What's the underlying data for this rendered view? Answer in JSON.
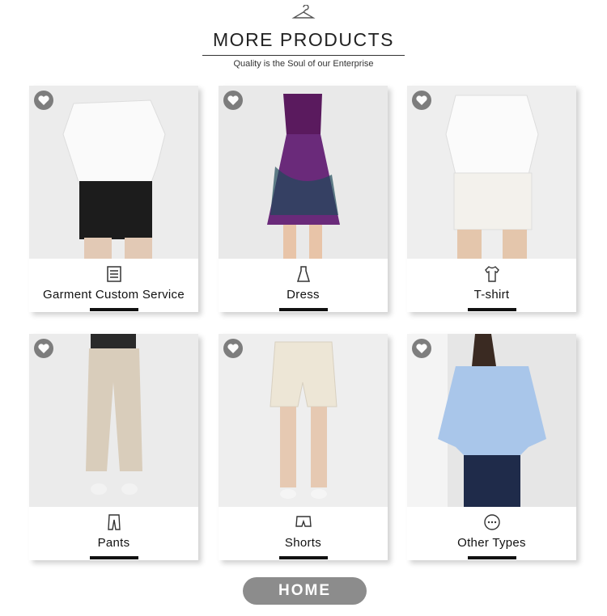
{
  "header": {
    "title": "MORE PRODUCTS",
    "subtitle": "Quality is the Soul of our Enterprise",
    "icon": "hanger-icon"
  },
  "categories": [
    {
      "label": "Garment Custom Service",
      "icon": "clipboard-list-icon",
      "photo": "white-blouse-black-denim-shorts",
      "bg": "#ececec"
    },
    {
      "label": "Dress",
      "icon": "dress-icon",
      "photo": "purple-print-dress",
      "bg": "#e9e9e9"
    },
    {
      "label": "T-shirt",
      "icon": "tshirt-icon",
      "photo": "white-tee-white-shorts",
      "bg": "#eeeeee"
    },
    {
      "label": "Pants",
      "icon": "pants-icon",
      "photo": "beige-trousers",
      "bg": "#ebebeb"
    },
    {
      "label": "Shorts",
      "icon": "shorts-icon",
      "photo": "cream-shorts",
      "bg": "#eeeeee"
    },
    {
      "label": "Other Types",
      "icon": "more-dots-icon",
      "photo": "blue-striped-shirt",
      "bg": "#e6e6e6"
    }
  ],
  "favorite_icon": "heart-icon",
  "home_button": {
    "label": "HOME"
  },
  "colors": {
    "accent": "#111111",
    "button": "#8c8c8c",
    "heart_badge": "#6a6a6a"
  }
}
